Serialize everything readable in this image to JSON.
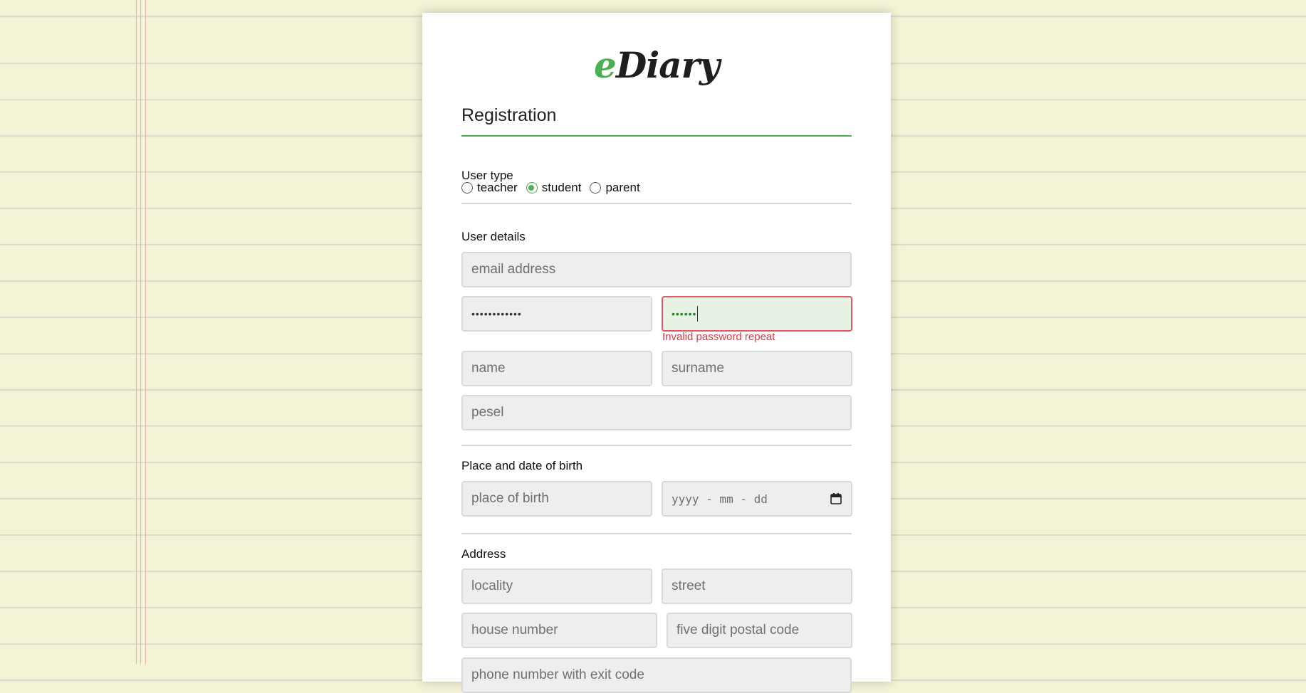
{
  "logo": {
    "e": "e",
    "rest": "Diary"
  },
  "form": {
    "title": "Registration",
    "user_type": {
      "label": "User type",
      "options": [
        "teacher",
        "student",
        "parent"
      ],
      "selected": "student"
    },
    "user_details": {
      "label": "User details",
      "email_placeholder": "email address",
      "password_value": "••••••••••••",
      "password_repeat_value": "••••••",
      "password_repeat_error": "Invalid password repeat",
      "name_placeholder": "name",
      "surname_placeholder": "surname",
      "pesel_placeholder": "pesel"
    },
    "birth": {
      "label": "Place and date of birth",
      "place_placeholder": "place of birth",
      "date_placeholder": "yyyy - mm - dd"
    },
    "address": {
      "label": "Address",
      "locality_placeholder": "locality",
      "street_placeholder": "street",
      "house_number_placeholder": "house number",
      "postal_code_placeholder": "five digit postal code",
      "phone_placeholder": "phone number with exit code"
    }
  },
  "colors": {
    "accent": "#4caf50",
    "background": "#f4f3d6",
    "error": "#dc3545"
  },
  "icons": [
    "calendar-icon"
  ]
}
